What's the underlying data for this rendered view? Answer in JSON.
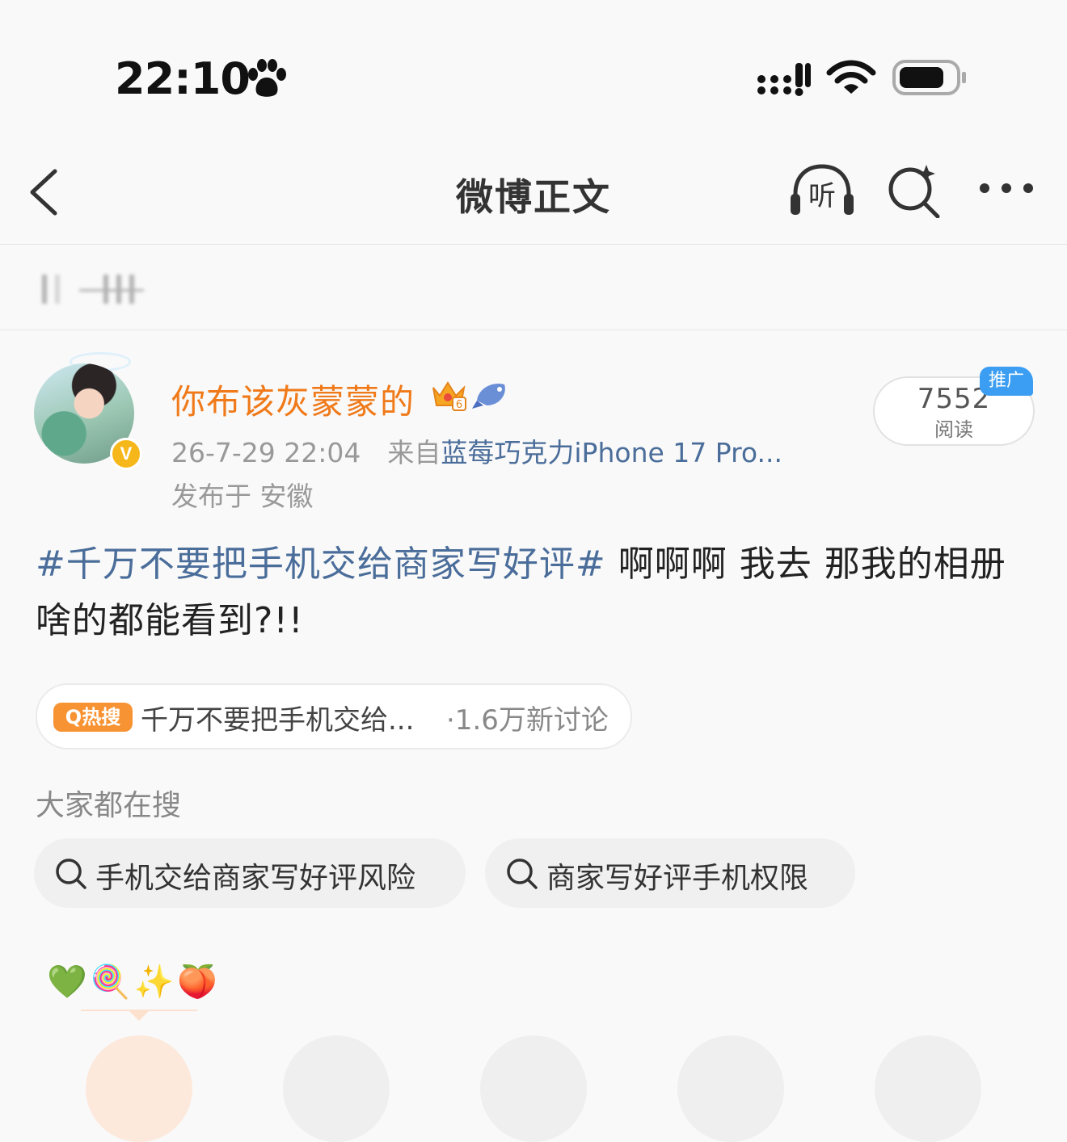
{
  "status_bar": {
    "time": "22:10"
  },
  "nav": {
    "title": "微博正文",
    "listen_label": "听"
  },
  "post": {
    "user_name": "你布该灰蒙蒙的",
    "verified_label": "V",
    "crown_level": "6",
    "date": "26-7-29 22:04",
    "source_prefix": "来自",
    "source": "蓝莓巧克力iPhone 17 Pro...",
    "location": "发布于 安徽",
    "reads_count": "7552",
    "reads_label": "阅读",
    "promo_tag": "推广",
    "hashtag": "#千万不要把手机交给商家写好评#",
    "body_text": " 啊啊啊 我去 那我的相册啥的都能看到?!!"
  },
  "hot_search": {
    "badge": "Q热搜",
    "text": "千万不要把手机交给...",
    "count": "·1.6万新讨论"
  },
  "everyone_searching": {
    "label": "大家都在搜",
    "items": [
      "手机交给商家写好评风险",
      "商家写好评手机权限"
    ]
  },
  "emoji_row": "💚🍭✨🍑"
}
